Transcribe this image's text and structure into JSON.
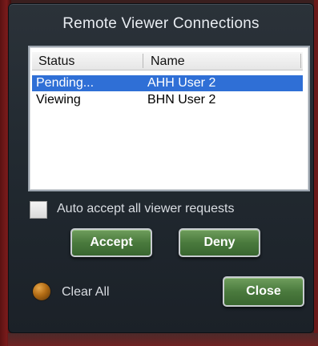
{
  "dialog": {
    "title": "Remote Viewer Connections"
  },
  "table": {
    "columns": [
      "Status",
      "Name"
    ],
    "rows": [
      {
        "status": "Pending...",
        "name": "AHH User 2",
        "selected": true
      },
      {
        "status": "Viewing",
        "name": "BHN User 2",
        "selected": false
      }
    ]
  },
  "auto_accept": {
    "label": "Auto accept all viewer requests",
    "checked": false
  },
  "buttons": {
    "accept": "Accept",
    "deny": "Deny",
    "close": "Close"
  },
  "clear_all": {
    "label": "Clear All"
  },
  "colors": {
    "accent_selected": "#2f6fd6",
    "button_green": "#4a7a3d",
    "orb_amber": "#b16b14"
  }
}
